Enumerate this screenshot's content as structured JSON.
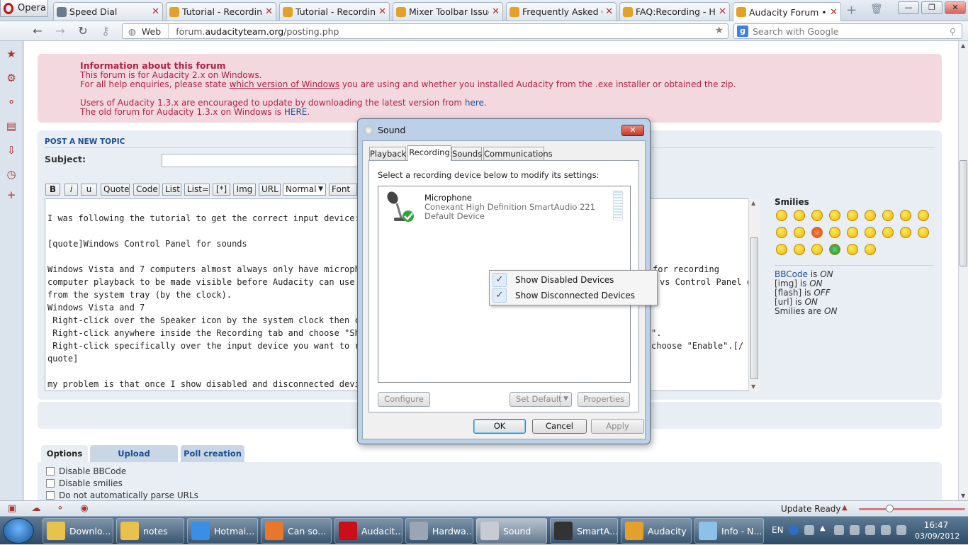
{
  "browser": {
    "opera_label": "Opera",
    "tabs": [
      {
        "title": "Speed Dial"
      },
      {
        "title": "Tutorial - Recording ..."
      },
      {
        "title": "Tutorial - Recording ..."
      },
      {
        "title": "Mixer Toolbar Issues..."
      },
      {
        "title": "Frequently Asked Q..."
      },
      {
        "title": "FAQ:Recording - Ho..."
      },
      {
        "title": "Audacity Forum • P..."
      }
    ],
    "address": {
      "scheme_label": "Web",
      "url_prefix": "forum.",
      "url_domain": "audacityteam.org",
      "url_path": "/posting.php"
    },
    "search_placeholder": "Search with Google",
    "status": {
      "update_label": "Update Ready"
    },
    "zoom_fraction": 0.27
  },
  "info_box": {
    "title": "Information about this forum",
    "line1": "This forum is for Audacity 2.x on Windows.",
    "line2_pre": "For all help enquiries, please state ",
    "line2_link": "which version of Windows",
    "line2_post": " you are using and whether you installed Audacity from the .exe installer or obtained the zip.",
    "line3_pre": "Users of Audacity 1.3.x are encouraged to update by downloading the latest version from ",
    "line3_link": "here",
    "line3_post": ".",
    "line4_pre": "The old forum for Audacity 1.3.x on Windows is ",
    "line4_link": "HERE",
    "line4_post": "."
  },
  "post_form": {
    "heading": "POST A NEW TOPIC",
    "subject_label": "Subject:",
    "format_buttons": [
      "B",
      "i",
      "u",
      "Quote",
      "Code",
      "List",
      "List=",
      "[*]",
      "Img",
      "URL"
    ],
    "font_size_select": "Normal",
    "font_color_label": "Font co",
    "editor_lines": [
      "I was following the tutorial to get the correct input device:",
      "",
      "[quote]Windows Control Panel for sounds",
      "",
      "Windows Vista and 7 computers almost always only have microphone inputs",
      "computer playback to be made visible before Audacity can use it. To show",
      "from the system tray (by the clock).",
      "Windows Vista and 7",
      " Right-click over the Speaker icon by the system clock then choose Recordi",
      " Right-click anywhere inside the Recording tab and choose \"Show disabled d",
      " Right-click specifically over the input device you want to record with (in th",
      "quote]",
      "",
      "my problem is that once I show disabled and disconnected devices...I don't"
    ],
    "editor_right_fragments": [
      "for recording",
      "vs Control Panel or",
      "\".",
      "choose \"Enable\".[/"
    ],
    "smilies_heading": "Smilies",
    "bbcode_status": [
      {
        "label": "BBCode",
        "suffix": " is ",
        "state": "ON"
      },
      {
        "label": "[img]",
        "suffix": " is ",
        "state": "ON"
      },
      {
        "label": "[flash]",
        "suffix": " is ",
        "state": "OFF"
      },
      {
        "label": "[url]",
        "suffix": " is ",
        "state": "ON"
      },
      {
        "label": "Smilies",
        "suffix": " are ",
        "state": "ON"
      }
    ]
  },
  "options": {
    "tabs": [
      "Options",
      "Upload attachment",
      "Poll creation"
    ],
    "checkboxes": [
      "Disable BBCode",
      "Disable smilies",
      "Do not automatically parse URLs"
    ]
  },
  "sound_dialog": {
    "title": "Sound",
    "tabs": [
      "Playback",
      "Recording",
      "Sounds",
      "Communications"
    ],
    "instruction": "Select a recording device below to modify its settings:",
    "device": {
      "name": "Microphone",
      "driver": "Conexant High Definition SmartAudio 221",
      "status": "Default Device"
    },
    "buttons": {
      "configure": "Configure",
      "set_default": "Set Default",
      "properties": "Properties",
      "ok": "OK",
      "cancel": "Cancel",
      "apply": "Apply"
    },
    "context_menu": [
      {
        "label": "Show Disabled Devices",
        "checked": true
      },
      {
        "label": "Show Disconnected Devices",
        "checked": true
      }
    ]
  },
  "taskbar": {
    "items": [
      {
        "label": "Downlo...",
        "icon": "folder-icon",
        "color": "#e8c24a"
      },
      {
        "label": "notes",
        "icon": "folder-icon",
        "color": "#e8c24a"
      },
      {
        "label": "Hotmai...",
        "icon": "ie-icon",
        "color": "#3a8ee6"
      },
      {
        "label": "Can so...",
        "icon": "firefox-icon",
        "color": "#e8762b"
      },
      {
        "label": "Audacit...",
        "icon": "opera-icon",
        "color": "#cc0f16"
      },
      {
        "label": "Hardwa...",
        "icon": "hardware-icon",
        "color": "#9aa6b3"
      },
      {
        "label": "Sound",
        "icon": "speaker-icon",
        "color": "#c7ccd2"
      },
      {
        "label": "SmartA...",
        "icon": "headphones-icon",
        "color": "#333333"
      },
      {
        "label": "Audacity",
        "icon": "audacity-icon",
        "color": "#e2a12b"
      },
      {
        "label": "Info - N...",
        "icon": "notepad-icon",
        "color": "#8ec1e8"
      }
    ],
    "lang": "EN",
    "time": "16:47",
    "date": "03/09/2012"
  }
}
